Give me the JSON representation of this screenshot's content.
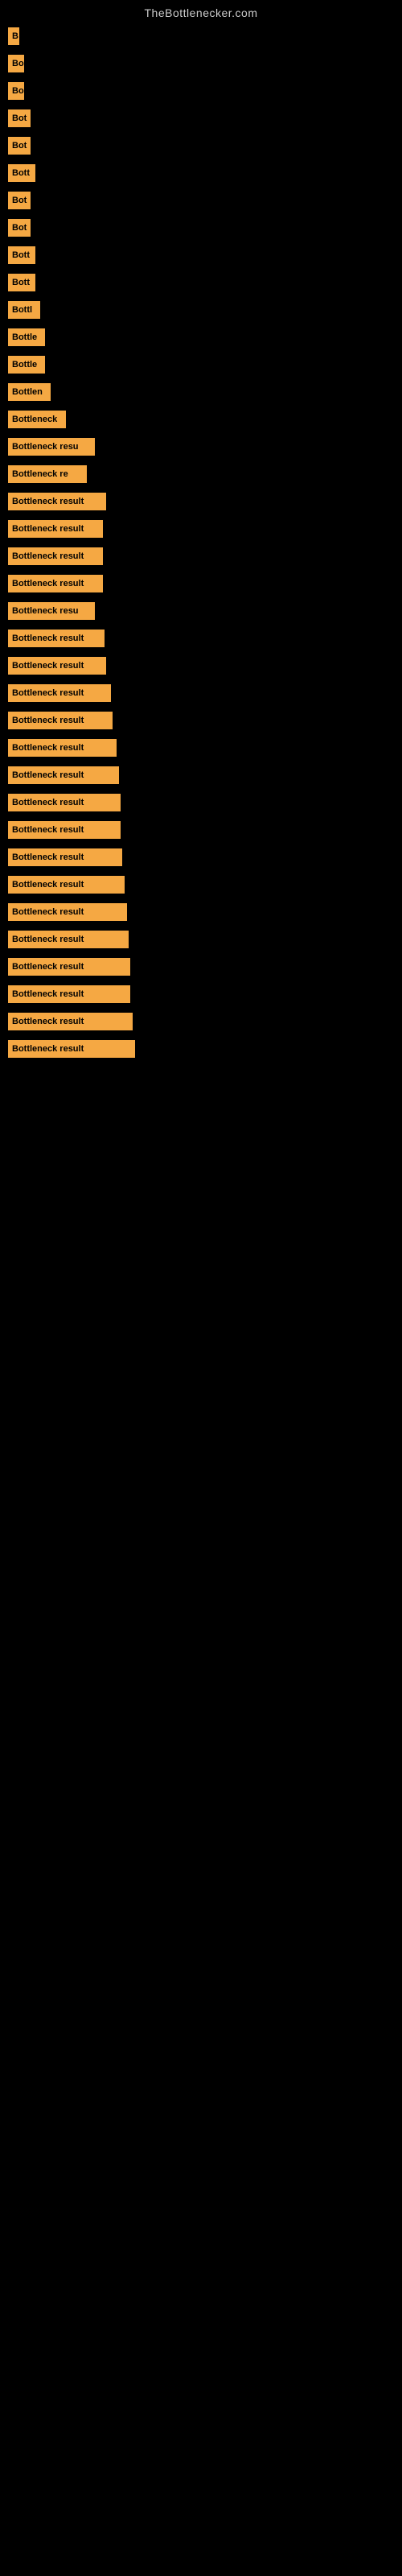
{
  "site_title": "TheBottlenecker.com",
  "bars": [
    {
      "label": "B",
      "width": 14
    },
    {
      "label": "Bo",
      "width": 20
    },
    {
      "label": "Bo",
      "width": 20
    },
    {
      "label": "Bot",
      "width": 28
    },
    {
      "label": "Bot",
      "width": 28
    },
    {
      "label": "Bott",
      "width": 34
    },
    {
      "label": "Bot",
      "width": 28
    },
    {
      "label": "Bot",
      "width": 28
    },
    {
      "label": "Bott",
      "width": 34
    },
    {
      "label": "Bott",
      "width": 34
    },
    {
      "label": "Bottl",
      "width": 40
    },
    {
      "label": "Bottle",
      "width": 46
    },
    {
      "label": "Bottle",
      "width": 46
    },
    {
      "label": "Bottlen",
      "width": 53
    },
    {
      "label": "Bottleneck",
      "width": 72
    },
    {
      "label": "Bottleneck resu",
      "width": 108
    },
    {
      "label": "Bottleneck re",
      "width": 98
    },
    {
      "label": "Bottleneck result",
      "width": 122
    },
    {
      "label": "Bottleneck result",
      "width": 118
    },
    {
      "label": "Bottleneck result",
      "width": 118
    },
    {
      "label": "Bottleneck result",
      "width": 118
    },
    {
      "label": "Bottleneck resu",
      "width": 108
    },
    {
      "label": "Bottleneck result",
      "width": 120
    },
    {
      "label": "Bottleneck result",
      "width": 122
    },
    {
      "label": "Bottleneck result",
      "width": 128
    },
    {
      "label": "Bottleneck result",
      "width": 130
    },
    {
      "label": "Bottleneck result",
      "width": 135
    },
    {
      "label": "Bottleneck result",
      "width": 138
    },
    {
      "label": "Bottleneck result",
      "width": 140
    },
    {
      "label": "Bottleneck result",
      "width": 140
    },
    {
      "label": "Bottleneck result",
      "width": 142
    },
    {
      "label": "Bottleneck result",
      "width": 145
    },
    {
      "label": "Bottleneck result",
      "width": 148
    },
    {
      "label": "Bottleneck result",
      "width": 150
    },
    {
      "label": "Bottleneck result",
      "width": 152
    },
    {
      "label": "Bottleneck result",
      "width": 152
    },
    {
      "label": "Bottleneck result",
      "width": 155
    },
    {
      "label": "Bottleneck result",
      "width": 158
    }
  ]
}
